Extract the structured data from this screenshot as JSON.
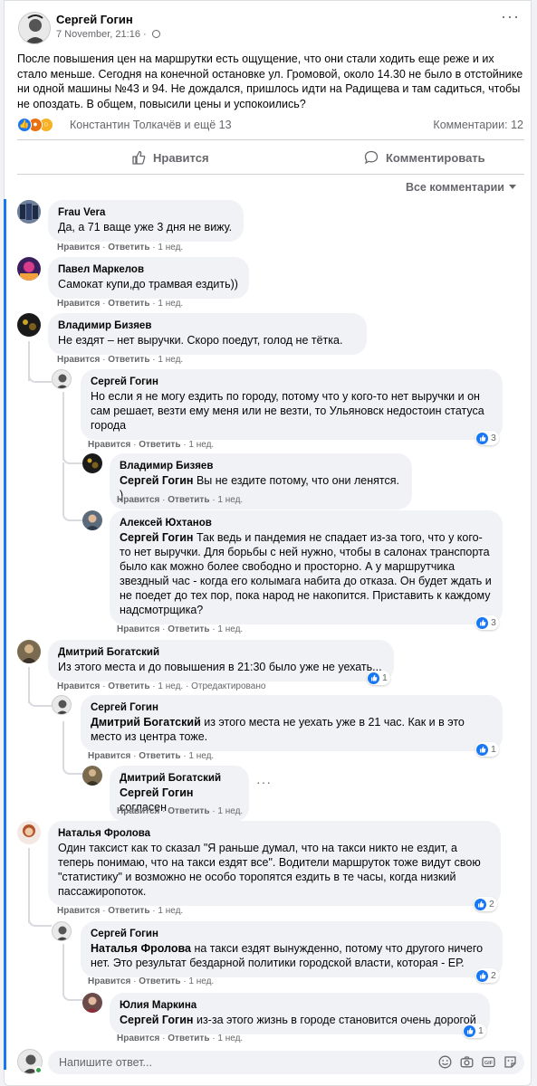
{
  "post": {
    "author": "Сергей Гогин",
    "date": "7 November, 21:16",
    "separator": "·",
    "text": "После повышения цен на маршрутки есть ощущение, что они стали ходить еще реже и их стало меньше. Сегодня на конечной остановке ул. Громовой, около 14.30 не было в отстойнике ни одной машины №43 и 94. Не дождался, пришлось идти на Радищева и там садиться, чтобы не опоздать. В общем, повысили цены и успокоились?",
    "reactors": "Константин Толкачёв и ещё 13",
    "comments_count": "Комментарии: 12",
    "more": "···"
  },
  "actions": {
    "like": "Нравится",
    "comment": "Комментировать"
  },
  "sort_label": "Все комментарии",
  "comments": [
    {
      "name": "Frau Vera",
      "mention": "",
      "text": "Да, а 71 ваще уже 3 дня не вижу.",
      "like": "Нравится",
      "reply": "Ответить",
      "time": "1 нед.",
      "sep": "·"
    },
    {
      "name": "Павел Маркелов",
      "mention": "",
      "text": "Самокат купи,до трамвая ездить))",
      "like": "Нравится",
      "reply": "Ответить",
      "time": "1 нед.",
      "sep": "·"
    },
    {
      "name": "Владимир Бизяев",
      "mention": "",
      "text": "Не ездят – нет выручки. Скоро поедут, голод не тётка.",
      "like": "Нравится",
      "reply": "Ответить",
      "time": "1 нед.",
      "sep": "·"
    },
    {
      "name": "Сергей Гогин",
      "mention": "",
      "text": "Но если я не могу ездить по городу, потому что у кого-то нет выручки и он сам решает, везти ему меня или не везти, то Ульяновск недостоин статуса города",
      "like": "Нравится",
      "reply": "Ответить",
      "time": "1 нед.",
      "sep": "·",
      "likes": "3"
    },
    {
      "name": "Владимир Бизяев",
      "mention": "Сергей Гогин",
      "text": " Вы не ездите потому, что они ленятся. )",
      "like": "Нравится",
      "reply": "Ответить",
      "time": "1 нед.",
      "sep": "·"
    },
    {
      "name": "Алексей Юхтанов",
      "mention": "Сергей Гогин",
      "text": " Так ведь и пандемия не спадает из-за того, что у кого-то нет выручки. Для борьбы с ней нужно, чтобы в салонах транспорта было как можно более свободно и просторно. А у маршрутчика звездный час - когда его колымага набита до отказа. Он будет ждать и не поедет до тех пор, пока народ не накопится. Приставить к каждому надсмотрщика?",
      "like": "Нравится",
      "reply": "Ответить",
      "time": "1 нед.",
      "sep": "·",
      "likes": "3"
    },
    {
      "name": "Дмитрий Богатский",
      "mention": "",
      "text": "Из этого места и до повышения в 21:30 было уже не уехать...",
      "like": "Нравится",
      "reply": "Ответить",
      "time": "1 нед.",
      "sep": "·",
      "edited": "Отредактировано",
      "likes": "1"
    },
    {
      "name": "Сергей Гогин",
      "mention": "Дмитрий Богатский",
      "text": " из этого места не уехать уже в 21 час. Как и в это место из центра тоже.",
      "like": "Нравится",
      "reply": "Ответить",
      "time": "1 нед.",
      "sep": "·",
      "likes": "1"
    },
    {
      "name": "Дмитрий Богатский",
      "mention": "Сергей Гогин",
      "text": " согласен",
      "like": "Нравится",
      "reply": "Ответить",
      "time": "1 нед.",
      "sep": "·"
    },
    {
      "name": "Наталья Фролова",
      "mention": "",
      "text": "Один таксист как то сказал \"Я раньше думал, что на такси никто не ездит, а теперь понимаю, что на такси ездят все\". Водители маршруток тоже видут свою \"статистику\" и возможно не особо торопятся ездить в те часы, когда низкий пассажиропоток.",
      "like": "Нравится",
      "reply": "Ответить",
      "time": "1 нед.",
      "sep": "·",
      "likes": "2"
    },
    {
      "name": "Сергей Гогин",
      "mention": "Наталья Фролова",
      "text": " на такси ездят вынужденно, потому что другого ничего нет. Это результат бездарной политики городской власти, которая - ЕР.",
      "like": "Нравится",
      "reply": "Ответить",
      "time": "1 нед.",
      "sep": "·",
      "likes": "2"
    },
    {
      "name": "Юлия Маркина",
      "mention": "Сергей Гогин",
      "text": " из-за этого жизнь в городе становится очень дорогой",
      "like": "Нравится",
      "reply": "Ответить",
      "time": "1 нед.",
      "sep": "·",
      "likes": "1"
    }
  ],
  "reply_box": {
    "placeholder": "Напишите ответ..."
  },
  "colors": {
    "accent": "#1877f2",
    "bubble": "#f0f2f5",
    "muted": "#65676b"
  }
}
